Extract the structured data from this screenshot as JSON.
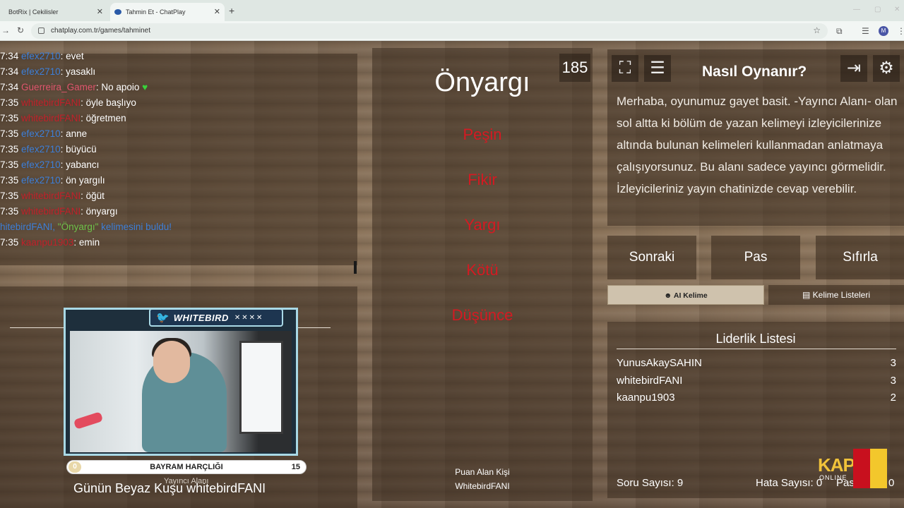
{
  "browser": {
    "tabs": [
      {
        "label": "BotRix | Cekilisler",
        "active": false
      },
      {
        "label": "Tahmin Et - ChatPlay",
        "active": true
      }
    ],
    "url": "chatplay.com.tr/games/tahminet",
    "profile_initial": "M"
  },
  "chat": {
    "messages": [
      {
        "time": "7:34",
        "user": "efex2710",
        "text": ": evet",
        "color": "blue"
      },
      {
        "time": "7:34",
        "user": "efex2710",
        "text": ": yasaklı",
        "color": "blue"
      },
      {
        "time": "7:34",
        "user": "Guerreira_Gamer",
        "text": ": No apoio",
        "color": "pink"
      },
      {
        "time": "7:35",
        "user": "whitebirdFANI",
        "text": ": öyle başlıyo",
        "color": "red"
      },
      {
        "time": "7:35",
        "user": "whitebirdFANI",
        "text": ": öğretmen",
        "color": "red"
      },
      {
        "time": "7:35",
        "user": "efex2710",
        "text": ": anne",
        "color": "blue"
      },
      {
        "time": "7:35",
        "user": "efex2710",
        "text": ": büyücü",
        "color": "blue"
      },
      {
        "time": "7:35",
        "user": "efex2710",
        "text": ": yabancı",
        "color": "blue"
      },
      {
        "time": "7:35",
        "user": "efex2710",
        "text": ": ön yargılı",
        "color": "blue"
      },
      {
        "time": "7:35",
        "user": "whitebirdFANI",
        "text": ": öğüt",
        "color": "red"
      },
      {
        "time": "7:35",
        "user": "whitebirdFANI",
        "text": ": önyargı",
        "color": "red"
      },
      {
        "time": "7:35",
        "user": "kaanpu1903",
        "text": ": emin",
        "color": "red"
      }
    ],
    "system_prefix": "hitebirdFANI, ",
    "system_word": "\"Önyargı\"",
    "system_suffix": " kelimesini buldu!"
  },
  "stream": {
    "handle": "WHITEBIRD",
    "goal_title": "BAYRAM HARÇLIĞI",
    "goal_current": "0",
    "goal_max": "15",
    "streamer_area_label": "Yayıncı Alanı",
    "caption": "Günün Beyaz Kuşu whitebirdFANI"
  },
  "game": {
    "countdown": "185",
    "word": "Önyargı",
    "taboo_words": [
      "Peşin",
      "Fikir",
      "Yargı",
      "Kötü",
      "Düşünce"
    ],
    "scorer_label": "Puan Alan Kişi",
    "scorer_name": "WhitebirdFANI"
  },
  "howto": {
    "title": "Nasıl Oynanır?",
    "text": "Merhaba, oyunumuz gayet basit. -Yayıncı Alanı- olan sol altta ki bölüm de yazan kelimeyi izleyicilerinize altında bulunan kelimeleri kullanmadan anlatmaya çalışıyorsunuz. Bu alanı sadece yayıncı görmelidir. İzleyicileriniz yayın chatinizde cevap verebilir."
  },
  "buttons": {
    "next": "Sonraki",
    "pass": "Pas",
    "reset": "Sıfırla",
    "ai_word": "AI Kelime",
    "word_lists": "Kelime Listeleri"
  },
  "leaderboard": {
    "title": "Liderlik Listesi",
    "rows": [
      {
        "name": "YunusAkaySAHIN",
        "score": "3"
      },
      {
        "name": "whitebirdFANI",
        "score": "3"
      },
      {
        "name": "kaanpu1903",
        "score": "2"
      }
    ]
  },
  "stats": {
    "questions": "Soru Sayısı: 9",
    "errors": "Hata Sayısı: 0",
    "passes_label": "Pas",
    "passes_value": "0"
  },
  "watermark": {
    "brand": "KAP",
    "sub": "ONLINE"
  },
  "colors": {
    "taboo": "#d41a22",
    "user_blue": "#3d7fd8",
    "user_red": "#c2202a",
    "ai_button": "#cfc2ad"
  }
}
